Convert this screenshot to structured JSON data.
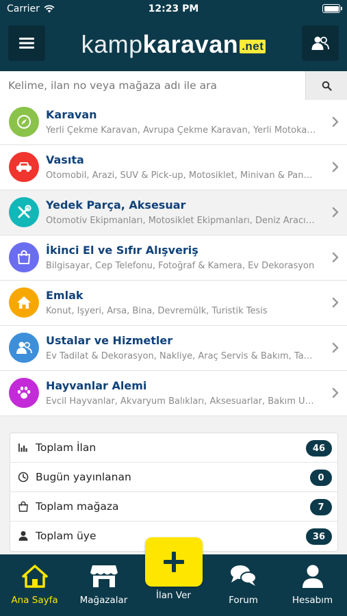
{
  "status_bar": {
    "carrier": "Carrier",
    "time": "12:23 PM"
  },
  "header": {
    "logo_light": "kamp",
    "logo_bold": "karavan",
    "logo_badge": ".net"
  },
  "search": {
    "placeholder": "Kelime, ilan no veya mağaza adı ile ara",
    "value": ""
  },
  "categories": [
    {
      "title": "Karavan",
      "subtitle": "Yerli Çekme Karavan, Avrupa Çekme Karavan, Yerli Motokaravan",
      "color": "#8bc34a",
      "icon": "compass-icon"
    },
    {
      "title": "Vasıta",
      "subtitle": "Otomobil, Arazi, SUV & Pick-up, Motosiklet, Minivan & Panelvan",
      "color": "#f0342e",
      "icon": "car-icon"
    },
    {
      "title": "Yedek Parça, Aksesuar",
      "subtitle": "Otomotiv Ekipmanları, Motosiklet Ekipmanları, Deniz Aracı Ekipmanları",
      "color": "#12b7b8",
      "icon": "tools-icon"
    },
    {
      "title": "İkinci El ve Sıfır Alışveriş",
      "subtitle": "Bilgisayar, Cep Telefonu, Fotoğraf & Kamera, Ev Dekorasyon",
      "color": "#6b6df0",
      "icon": "shopping-bag-icon"
    },
    {
      "title": "Emlak",
      "subtitle": "Konut, İşyeri, Arsa, Bina, Devremülk, Turistik Tesis",
      "color": "#f7a800",
      "icon": "house-icon"
    },
    {
      "title": "Ustalar ve Hizmetler",
      "subtitle": "Ev Tadilat & Dekorasyon, Nakliye, Araç Servis & Bakım, Tamir",
      "color": "#3d8fd9",
      "icon": "users-icon"
    },
    {
      "title": "Hayvanlar Alemi",
      "subtitle": "Evcil Hayvanlar, Akvaryum Balıkları, Aksesuarlar, Bakım Ürünleri",
      "color": "#c42bd8",
      "icon": "paw-icon"
    }
  ],
  "stats": [
    {
      "label": "Toplam İlan",
      "value": "46",
      "icon": "bar-chart-icon"
    },
    {
      "label": "Bugün yayınlanan",
      "value": "0",
      "icon": "clock-icon"
    },
    {
      "label": "Toplam mağaza",
      "value": "7",
      "icon": "shopping-bag-icon"
    },
    {
      "label": "Toplam üye",
      "value": "36",
      "icon": "user-icon"
    }
  ],
  "bottom_nav": {
    "tabs": [
      {
        "label": "Ana Sayfa",
        "icon": "home-icon",
        "active": true
      },
      {
        "label": "Mağazalar",
        "icon": "store-icon",
        "active": false
      },
      {
        "label": "İlan Ver",
        "icon": "plus-icon",
        "active": false
      },
      {
        "label": "Forum",
        "icon": "chat-icon",
        "active": false
      },
      {
        "label": "Hesabım",
        "icon": "user-icon",
        "active": false
      }
    ]
  },
  "colors": {
    "header_bg": "#0d3a4a",
    "accent_yellow": "#ffe600",
    "title_blue": "#10427a"
  }
}
